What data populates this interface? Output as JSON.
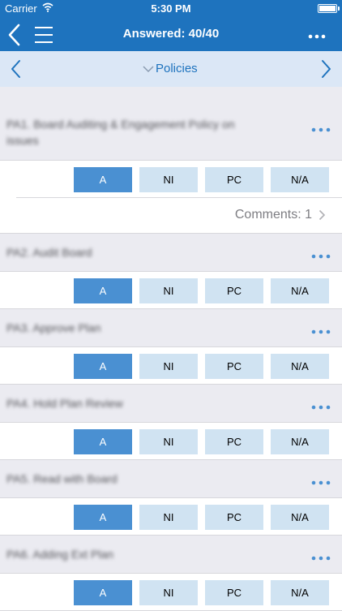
{
  "status_bar": {
    "carrier": "Carrier",
    "time": "5:30 PM"
  },
  "nav_bar": {
    "title": "Answered: 40/40"
  },
  "section_bar": {
    "label": "Policies"
  },
  "answer_options": [
    "A",
    "NI",
    "PC",
    "N/A"
  ],
  "questions": [
    {
      "text_line1": "PA1. Board Auditing & Engagement Policy on",
      "text_line2": "issues",
      "selected": "A",
      "comments_label": "Comments: 1"
    },
    {
      "text_line1": "PA2. Audit Board",
      "selected": "A"
    },
    {
      "text_line1": "PA3. Approve Plan",
      "selected": "A"
    },
    {
      "text_line1": "PA4. Hold Plan Review",
      "selected": "A"
    },
    {
      "text_line1": "PA5. Read with Board",
      "selected": "A"
    },
    {
      "text_line1": "PA6. Adding Ext Plan",
      "selected": "A"
    }
  ],
  "colors": {
    "accent": "#1e73be",
    "selected_button": "#4a90d2",
    "unselected_button": "#d0e3f2",
    "section_bar": "#dbe7f6",
    "question_bg": "#ebebf1"
  },
  "icons": [
    "wifi-icon",
    "battery-icon",
    "back-chevron-icon",
    "hamburger-menu-icon",
    "more-horizontal-icon",
    "chevron-left-icon",
    "chevron-right-icon",
    "chevron-down-icon",
    "disclosure-chevron-icon"
  ]
}
